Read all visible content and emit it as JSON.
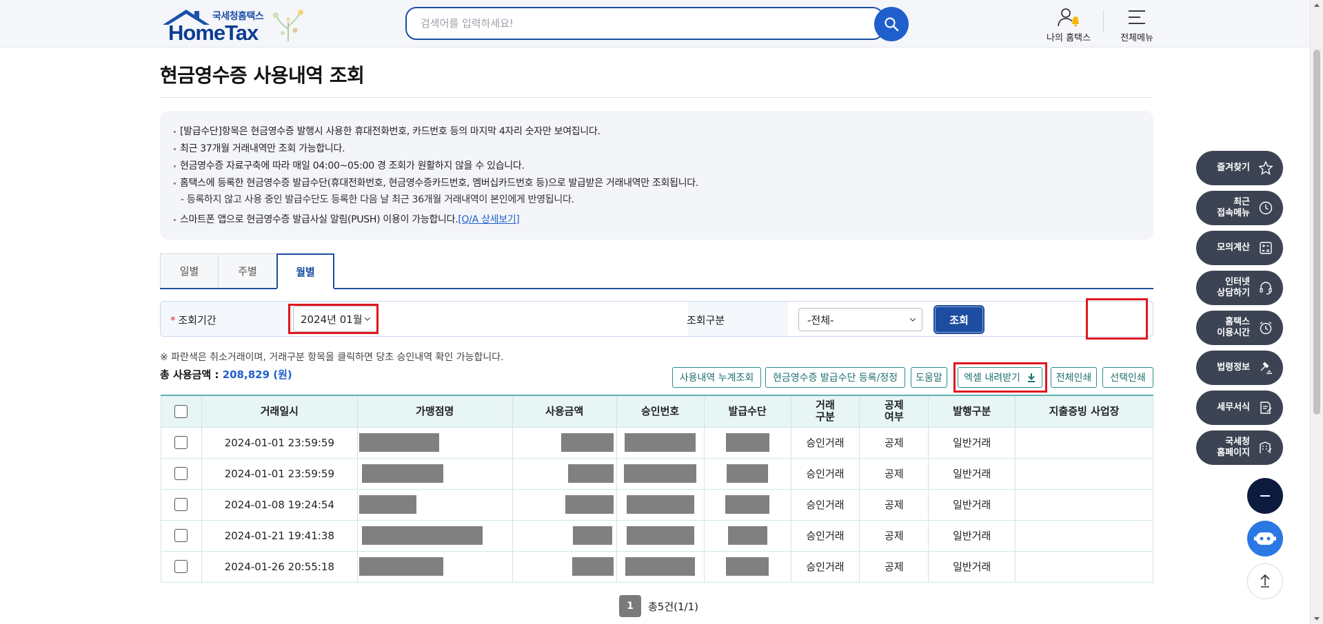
{
  "header": {
    "logo_sub": "국세청홈택스",
    "logo_main": "HomeTax",
    "search_placeholder": "검색어를 입력하세요!",
    "my_hometax": "나의 홈택스",
    "all_menu": "전체메뉴"
  },
  "page": {
    "title": "현금영수증 사용내역 조회"
  },
  "notice": {
    "lines": [
      "[발급수단]항목은 현금영수증 발행시 사용한 휴대전화번호, 카드번호 등의 마지막 4자리 숫자만 보여집니다.",
      "최근 37개월 거래내역만 조회 가능합니다.",
      "현금영수증 자료구축에 따라 매일 04:00~05:00 경 조회가 원활하지 않을 수 있습니다.",
      "홈택스에 등록한 현금영수증 발급수단(휴대전화번호, 현금영수증카드번호, 멤버십카드번호 등)으로 발급받은 거래내역만 조회됩니다.",
      "- 등록하지 않고 사용 중인 발급수단도 등록한 다음 날 최근 36개월 거래내역이 본인에게 반영됩니다.",
      "스마트폰 앱으로 현금영수증 발급사실 알림(PUSH) 이용이 가능합니다."
    ],
    "link": "[Q/A 상세보기]"
  },
  "tabs": [
    "일별",
    "주별",
    "월별"
  ],
  "active_tab": "월별",
  "filter": {
    "period_label": "조회기간",
    "period_value": "2024년 01월",
    "type_label": "조회구분",
    "type_value": "-전체-",
    "query_button": "조회"
  },
  "hint": "※ 파란색은 취소거래이며, 거래구분 항목을 클릭하면 당초 승인내역 확인 가능합니다.",
  "total": {
    "label": "총 사용금액 :",
    "amount": "208,829 (원)"
  },
  "actions": {
    "cumulative": "사용내역 누계조회",
    "register": "현금영수증 발급수단 등록/정정",
    "help": "도움말",
    "excel": "엑셀 내려받기",
    "print_all": "전체인쇄",
    "print_selected": "선택인쇄"
  },
  "table": {
    "headers": [
      "거래일시",
      "가맹점명",
      "사용금액",
      "승인번호",
      "발급수단",
      "거래\n구분",
      "공제\n여부",
      "발행구분",
      "지출증빙 사업장"
    ],
    "rows": [
      {
        "datetime": "2024-01-01 23:59:59",
        "type": "승인거래",
        "deduct": "공제",
        "issue": "일반거래"
      },
      {
        "datetime": "2024-01-01 23:59:59",
        "type": "승인거래",
        "deduct": "공제",
        "issue": "일반거래"
      },
      {
        "datetime": "2024-01-08 19:24:54",
        "type": "승인거래",
        "deduct": "공제",
        "issue": "일반거래"
      },
      {
        "datetime": "2024-01-21 19:41:38",
        "type": "승인거래",
        "deduct": "공제",
        "issue": "일반거래"
      },
      {
        "datetime": "2024-01-26 20:55:18",
        "type": "승인거래",
        "deduct": "공제",
        "issue": "일반거래"
      }
    ]
  },
  "pager": {
    "current": "1",
    "summary": "총5건(1/1)"
  },
  "quick_menu": {
    "bookmark": "즐겨찾기",
    "recent_1": "최근",
    "recent_2": "접속메뉴",
    "calc": "모의계산",
    "consult_1": "인터넷",
    "consult_2": "상담하기",
    "hours_1": "홈택스",
    "hours_2": "이용시간",
    "law": "법령정보",
    "forms": "세무서식",
    "nts_1": "국세청",
    "nts_2": "홈페이지"
  },
  "colors": {
    "brand": "#1c4da1",
    "accent": "#1f5fcc",
    "highlight": "#e0161e",
    "teal": "#2a8c8c",
    "quick_menu": "#3c4352"
  }
}
